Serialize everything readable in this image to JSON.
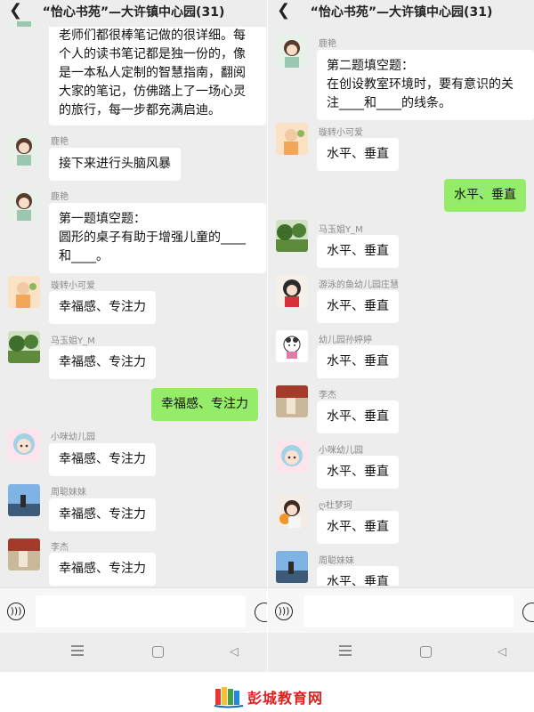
{
  "left": {
    "title": "“怡心书苑”—大许镇中心园(31)",
    "messages": [
      {
        "type": "text_partial",
        "text": "老师们都很棒笔记做的很详细。每个人的读书笔记都是独一份的，像是一本私人定制的智慧指南，翻阅大家的笔记，仿佛踏上了一场心灵的旅行，每一步都充满启迪。",
        "lines": [
          "老师们都很棒笔记做的很详细。每",
          "个人的读书笔记都是独一份的，像",
          "是一本私人定制的智慧指南，翻阅",
          "大家的笔记，仿佛踏上了一场心灵",
          "的旅行，每一步都充满启迪。"
        ]
      },
      {
        "sender": "鹿艳",
        "text": "接下来进行头脑风暴"
      },
      {
        "sender": "鹿艳",
        "lines": [
          "第一题填空题：",
          "圆形的桌子有助于增强儿童的____",
          "和____。"
        ]
      },
      {
        "sender": "璇转小可爱",
        "text": "幸福感、专注力"
      },
      {
        "sender": "马玉姐Y_M",
        "text": "幸福感、专注力"
      },
      {
        "sender": "me",
        "text": "幸福感、专注力"
      },
      {
        "sender": "小咪幼儿园",
        "text": "幸福感、专注力"
      },
      {
        "sender": "周聪妹妹",
        "text": "幸福感、专注力"
      },
      {
        "sender": "李杰",
        "text": "幸福感、专注力"
      }
    ]
  },
  "right": {
    "title": "“怡心书苑”—大许镇中心园(31)",
    "messages": [
      {
        "sender": "鹿艳",
        "lines": [
          "第二题填空题：",
          "在创设教室环境时，要有意识的关",
          "注____和____的线条。"
        ]
      },
      {
        "sender": "璇转小可爱",
        "text": "水平、垂直"
      },
      {
        "sender": "me",
        "text": "水平、垂直"
      },
      {
        "sender": "马玉姐Y_M",
        "text": "水平、垂直"
      },
      {
        "sender": "游泳的鱼幼儿园庄慧",
        "text": "水平、垂直"
      },
      {
        "sender": "幼儿园孙婷婷",
        "text": "水平、垂直"
      },
      {
        "sender": "李杰",
        "text": "水平、垂直"
      },
      {
        "sender": "小咪幼儿园",
        "text": "水平、垂直"
      },
      {
        "sender": "ღ杜梦珂",
        "text": "水平、垂直"
      },
      {
        "sender": "周聪妹妹",
        "text": "水平、垂直"
      }
    ]
  },
  "footer": {
    "site_name": "彭城教育网"
  },
  "icons": {
    "back": "chevron-left-icon",
    "voice": "voice-icon",
    "emoji": "emoji-icon",
    "menu": "menu-icon",
    "home": "home-icon",
    "nav_back": "triangle-back-icon"
  },
  "colors": {
    "my_bubble": "#95ec69",
    "chat_bg": "#ededed",
    "brand_red": "#e02020"
  }
}
